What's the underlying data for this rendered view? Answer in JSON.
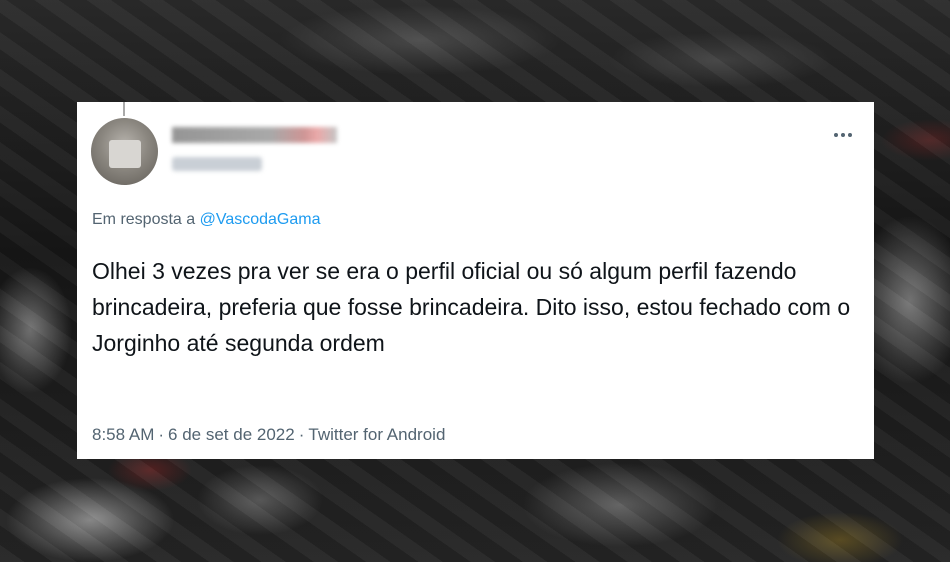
{
  "tweet": {
    "reply_prefix": "Em resposta a",
    "reply_mention": "@VascodaGama",
    "text": "Olhei 3 vezes pra ver se era o perfil oficial ou só algum perfil fazendo brincadeira, preferia que fosse brincadeira. Dito isso, estou fechado com o Jorginho até segunda ordem",
    "time": "8:58 AM",
    "date": "6 de set de 2022",
    "source": "Twitter for Android",
    "separator": "·"
  },
  "icons": {
    "more": "more-horizontal-icon"
  },
  "colors": {
    "mention": "#1d9bf0",
    "secondary_text": "#536471",
    "primary_text": "#0f1419",
    "card_bg": "#ffffff"
  }
}
